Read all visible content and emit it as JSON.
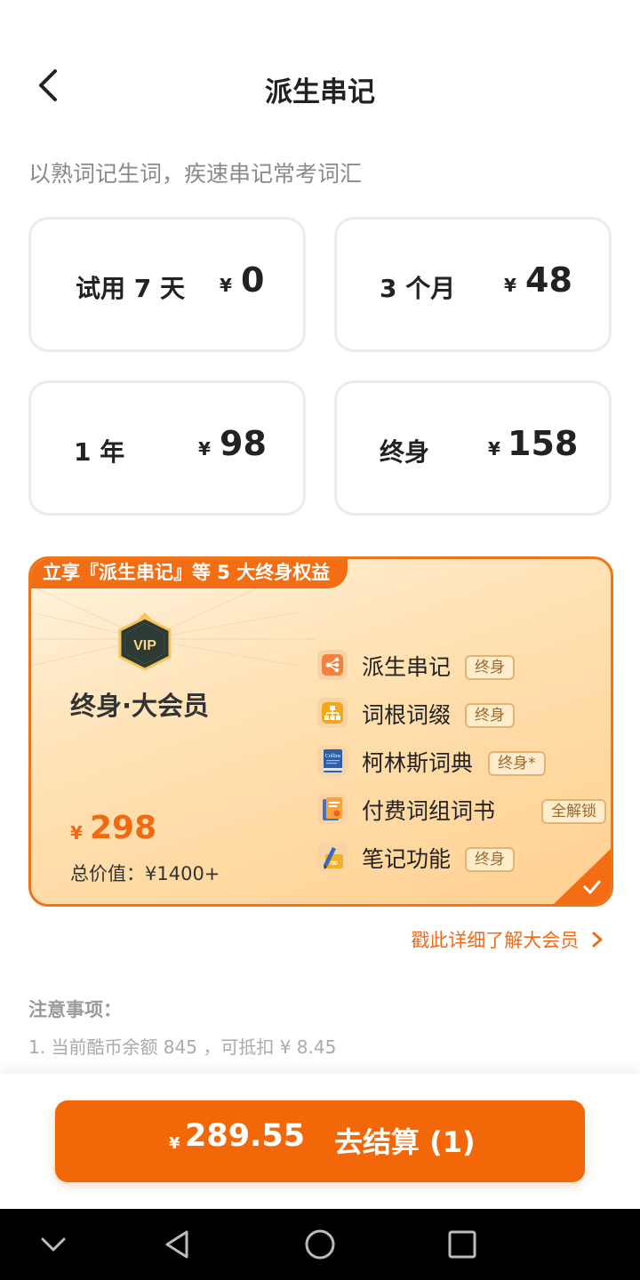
{
  "header": {
    "title": "派生串记"
  },
  "subtitle": "以熟词记生词，疾速串记常考词汇",
  "plans": [
    {
      "name": "试用 7 天",
      "currency": "¥",
      "price": "0"
    },
    {
      "name": "3 个月",
      "currency": "¥",
      "price": "48"
    },
    {
      "name": "1 年",
      "currency": "¥",
      "price": "98"
    },
    {
      "name": "终身",
      "currency": "¥",
      "price": "158"
    }
  ],
  "vip": {
    "banner": "立享『派生串记』等 5 大终身权益",
    "badge_text": "VIP",
    "title": "终身·大会员",
    "currency": "¥",
    "price": "298",
    "total_value": "总价值：¥1400+",
    "selected": true,
    "benefits": [
      {
        "label": "派生串记",
        "tag": "终身",
        "icon": "branch-icon"
      },
      {
        "label": "词根词缀",
        "tag": "终身",
        "icon": "hierarchy-icon"
      },
      {
        "label": "柯林斯词典",
        "tag": "终身*",
        "icon": "collins-book-icon",
        "icon_text": "Collins"
      },
      {
        "label": "付费词组词书",
        "tag": "全解锁",
        "icon": "books-icon"
      },
      {
        "label": "笔记功能",
        "tag": "终身",
        "icon": "pencil-note-icon"
      }
    ]
  },
  "learn_more": "戳此详细了解大会员",
  "notes": {
    "title": "注意事项：",
    "items": [
      "1. 当前酷币余额 845 ，可抵扣 ¥ 8.45"
    ]
  },
  "checkout": {
    "currency": "¥",
    "amount": "289.55",
    "label": "去结算 (1)"
  },
  "colors": {
    "accent": "#f26707",
    "card_border": "#ececec",
    "vip_border": "#f07418"
  }
}
